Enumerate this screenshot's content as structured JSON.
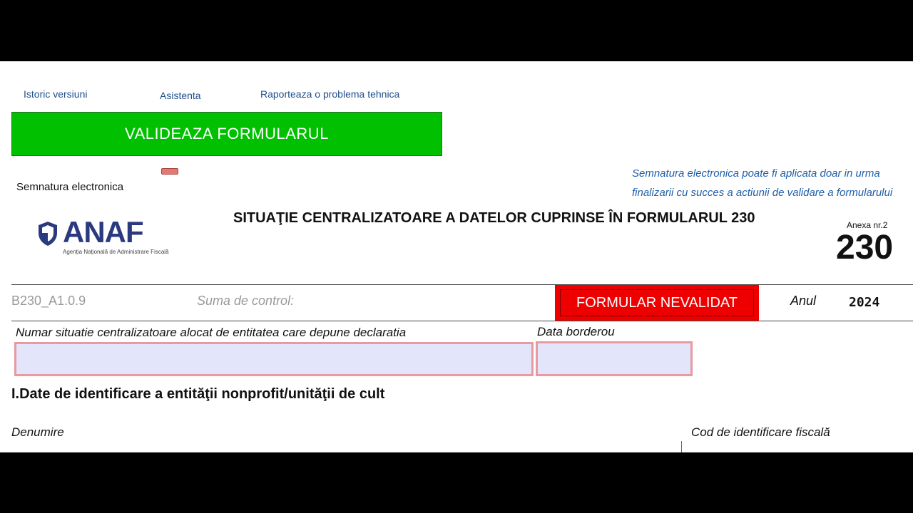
{
  "links": {
    "history": "Istoric versiuni",
    "assistance": "Asistenta",
    "report": "Raporteaza o problema tehnica"
  },
  "validate_button": "VALIDEAZA FORMULARUL",
  "signature": {
    "label": "Semnatura electronica",
    "note_line1": "Semnatura electronica poate fi aplicata doar in urma",
    "note_line2": "finalizarii cu succes a actiunii de validare a formularului"
  },
  "logo": {
    "name": "ANAF",
    "subtitle": "Agenția Națională de Administrare Fiscală"
  },
  "header": {
    "title": "SITUAŢIE CENTRALIZATOARE A DATELOR CUPRINSE ÎN FORMULARUL 230",
    "anexa": "Anexa nr.2",
    "form_number": "230"
  },
  "meta": {
    "version": "B230_A1.0.9",
    "control_label": "Suma de  control:",
    "status": "FORMULAR NEVALIDAT",
    "year_label": "Anul",
    "year_value": "2024"
  },
  "fields": {
    "situation_number_label": "Numar situatie centralizatoare alocat de entitatea care depune declaratia",
    "situation_number_value": "",
    "borderou_date_label": "Data borderou",
    "borderou_date_value": ""
  },
  "section1": {
    "title": "I.Date de identificare a entităţii nonprofit/unităţii de cult",
    "name_label": "Denumire",
    "cif_label": "Cod de identificare fiscală"
  },
  "colors": {
    "validate_green": "#00c000",
    "status_red": "#e00000",
    "input_fill": "#e3e5fb",
    "input_border": "#e89aa0",
    "link_blue": "#1f4e8c",
    "logo_navy": "#2b3a7e"
  }
}
